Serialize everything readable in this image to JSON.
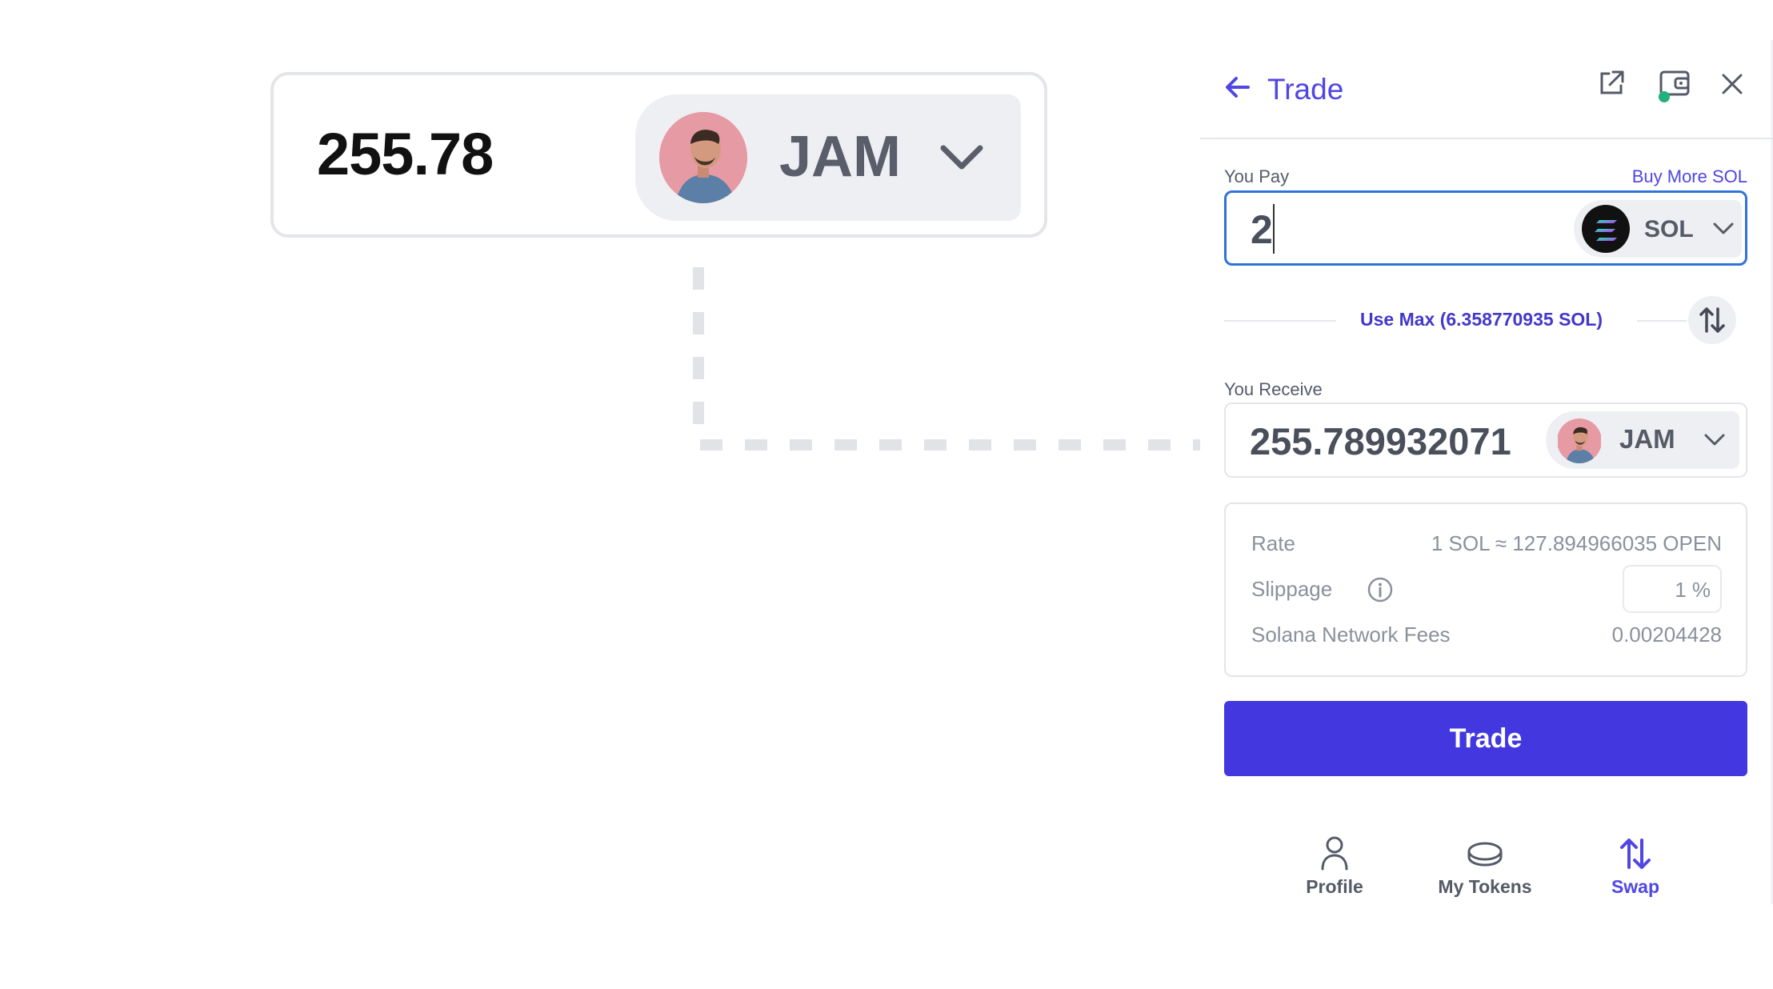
{
  "callout": {
    "amount": "255.78",
    "token_symbol": "JAM"
  },
  "panel": {
    "title": "Trade",
    "pay": {
      "label": "You Pay",
      "buy_more_link": "Buy More SOL",
      "amount": "2",
      "token_symbol": "SOL"
    },
    "use_max": "Use Max (6.358770935 SOL)",
    "receive": {
      "label": "You Receive",
      "amount": "255.789932071",
      "token_symbol": "JAM"
    },
    "details": {
      "rate_label": "Rate",
      "rate_value": "1 SOL ≈ 127.894966035 OPEN",
      "slippage_label": "Slippage",
      "slippage_value": "1 %",
      "fees_label": "Solana Network Fees",
      "fees_value": "0.00204428"
    },
    "trade_button": "Trade",
    "nav": [
      {
        "label": "Profile",
        "icon": "person-icon"
      },
      {
        "label": "My Tokens",
        "icon": "coins-icon"
      },
      {
        "label": "Swap",
        "icon": "swap-icon"
      }
    ]
  },
  "colors": {
    "accent": "#4f46e5",
    "trade_button": "#4338e0",
    "focus_border": "#2f73d9"
  }
}
